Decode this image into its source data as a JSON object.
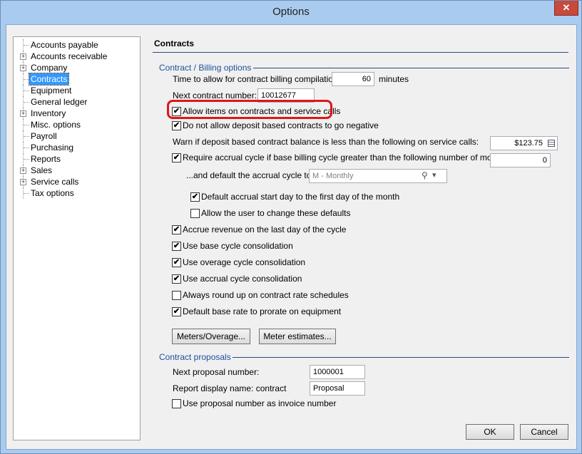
{
  "window": {
    "title": "Options",
    "close_glyph": "✕"
  },
  "tree": {
    "items": [
      {
        "label": "Accounts payable",
        "expandable": false
      },
      {
        "label": "Accounts receivable",
        "expandable": true
      },
      {
        "label": "Company",
        "expandable": true
      },
      {
        "label": "Contracts",
        "expandable": false,
        "selected": true
      },
      {
        "label": "Equipment",
        "expandable": false
      },
      {
        "label": "General ledger",
        "expandable": false
      },
      {
        "label": "Inventory",
        "expandable": true
      },
      {
        "label": "Misc. options",
        "expandable": false
      },
      {
        "label": "Payroll",
        "expandable": false
      },
      {
        "label": "Purchasing",
        "expandable": false
      },
      {
        "label": "Reports",
        "expandable": false
      },
      {
        "label": "Sales",
        "expandable": true
      },
      {
        "label": "Service calls",
        "expandable": true
      },
      {
        "label": "Tax options",
        "expandable": false
      }
    ]
  },
  "panel": {
    "heading": "Contracts",
    "billing": {
      "title": "Contract / Billing options",
      "compile_label": "Time to allow for contract billing compilation:",
      "compile_value": "60",
      "compile_unit": "minutes",
      "next_number_label": "Next contract number:",
      "next_number_value": "10012677",
      "allow_items": {
        "label": "Allow items on contracts and service calls",
        "checked": true
      },
      "no_negative": {
        "label": "Do not allow deposit based contracts to go negative",
        "checked": true
      },
      "warn_label": "Warn if deposit based contract balance is less than the following on service calls:",
      "warn_value": "$123.75",
      "require_accrual": {
        "label": "Require accrual cycle if base billing cycle greater than the following number of months:",
        "checked": true
      },
      "require_accrual_value": "0",
      "default_cycle_label": "...and default the accrual cycle to:",
      "default_cycle_value": "M - Monthly",
      "default_start": {
        "label": "Default accrual start day to the first day of the month",
        "checked": true
      },
      "allow_change": {
        "label": "Allow the user to change these defaults",
        "checked": false
      },
      "accrue_revenue": {
        "label": "Accrue revenue on the last day of the cycle",
        "checked": true
      },
      "base_consol": {
        "label": "Use base cycle consolidation",
        "checked": true
      },
      "overage_consol": {
        "label": "Use overage cycle consolidation",
        "checked": true
      },
      "accrual_consol": {
        "label": "Use accrual cycle consolidation",
        "checked": true
      },
      "round_up": {
        "label": "Always round up on contract rate schedules",
        "checked": false
      },
      "prorate": {
        "label": "Default base rate to prorate on equipment",
        "checked": true
      },
      "meters_btn": "Meters/Overage...",
      "estimates_btn": "Meter estimates..."
    },
    "proposals": {
      "title": "Contract proposals",
      "next_label": "Next proposal number:",
      "next_value": "1000001",
      "display_label": "Report display name: contract",
      "display_value": "Proposal",
      "use_as_invoice": {
        "label": "Use proposal number as invoice number",
        "checked": false
      }
    }
  },
  "footer": {
    "ok": "OK",
    "cancel": "Cancel"
  },
  "icons": {
    "checked_glyph": "✔",
    "expander_glyph": "+",
    "search_glyph": "⚲",
    "dropdown_glyph": "▾",
    "calendar": "calendar-icon"
  },
  "colors": {
    "highlight": "#e0151c",
    "group_title": "#1f4f9c",
    "selection": "#3399ff"
  }
}
